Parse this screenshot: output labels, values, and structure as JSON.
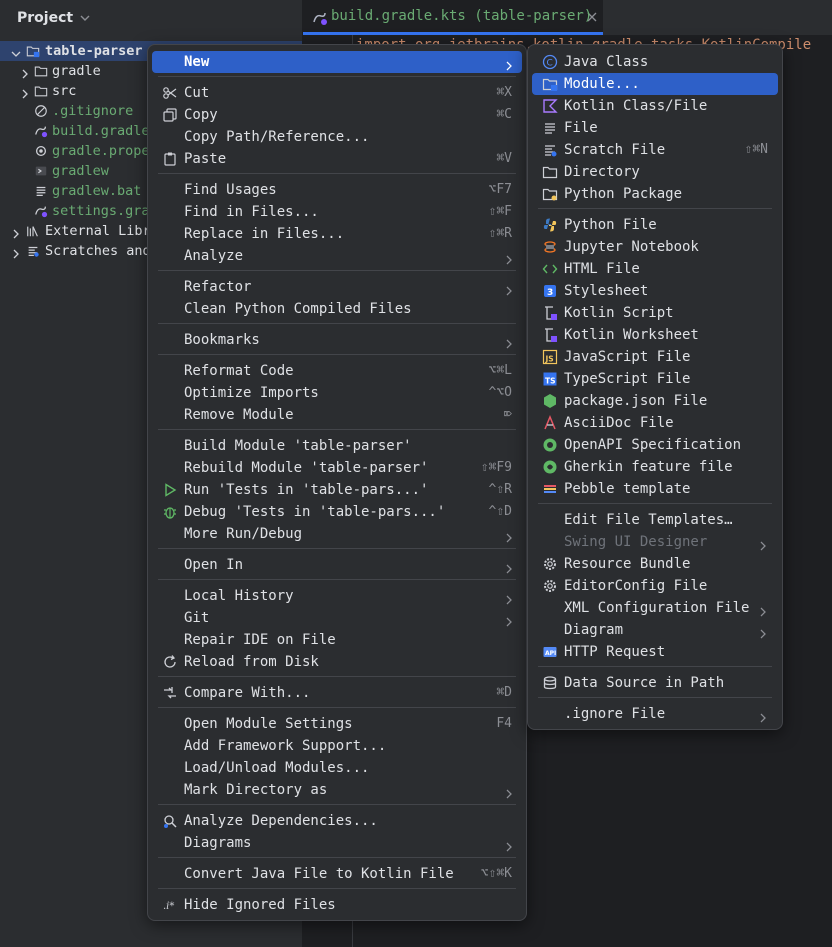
{
  "project_panel": {
    "title": "Project",
    "tree": [
      {
        "label": "table-parser",
        "icon": "module-folder-icon",
        "color": "#dfe1e5",
        "bold": true,
        "expanded": true
      },
      {
        "label": "gradle",
        "icon": "folder-icon",
        "color": "#dfe1e5"
      },
      {
        "label": "src",
        "icon": "folder-icon",
        "color": "#dfe1e5"
      },
      {
        "label": ".gitignore",
        "icon": "ignore-file-icon",
        "color": "#6aab73"
      },
      {
        "label": "build.gradle",
        "icon": "gradle-kts-icon",
        "color": "#6aab73"
      },
      {
        "label": "gradle.prope",
        "icon": "properties-file-icon",
        "color": "#6aab73"
      },
      {
        "label": "gradlew",
        "icon": "shell-script-icon",
        "color": "#6aab73"
      },
      {
        "label": "gradlew.bat",
        "icon": "text-file-icon",
        "color": "#6aab73"
      },
      {
        "label": "settings.gra",
        "icon": "gradle-kts-icon",
        "color": "#6aab73"
      },
      {
        "label": "External Libr",
        "icon": "library-icon",
        "color": "#dfe1e5"
      },
      {
        "label": "Scratches and",
        "icon": "scratches-icon",
        "color": "#dfe1e5"
      }
    ]
  },
  "editor": {
    "tab_label": "build.gradle.kts (table-parser)",
    "code_line": "import org.jetbrains.kotlin.gradle.tasks.KotlinCompile"
  },
  "context_menu": {
    "items": [
      {
        "label": "New",
        "shortcut": "",
        "submenu": true,
        "icon": ""
      },
      {
        "label": "Cut",
        "shortcut": "⌘X",
        "icon": "scissors-icon"
      },
      {
        "label": "Copy",
        "shortcut": "⌘C",
        "icon": "copy-icon"
      },
      {
        "label": "Copy Path/Reference...",
        "shortcut": "",
        "icon": ""
      },
      {
        "label": "Paste",
        "shortcut": "⌘V",
        "icon": "paste-icon"
      },
      {
        "label": "Find Usages",
        "shortcut": "⌥F7",
        "icon": ""
      },
      {
        "label": "Find in Files...",
        "shortcut": "⇧⌘F",
        "icon": ""
      },
      {
        "label": "Replace in Files...",
        "shortcut": "⇧⌘R",
        "icon": ""
      },
      {
        "label": "Analyze",
        "shortcut": "",
        "submenu": true,
        "icon": ""
      },
      {
        "label": "Refactor",
        "shortcut": "",
        "submenu": true,
        "icon": ""
      },
      {
        "label": "Clean Python Compiled Files",
        "shortcut": "",
        "icon": ""
      },
      {
        "label": "Bookmarks",
        "shortcut": "",
        "submenu": true,
        "icon": ""
      },
      {
        "label": "Reformat Code",
        "shortcut": "⌥⌘L",
        "icon": ""
      },
      {
        "label": "Optimize Imports",
        "shortcut": "^⌥O",
        "icon": ""
      },
      {
        "label": "Remove Module",
        "shortcut": "⌦",
        "icon": ""
      },
      {
        "label": "Build Module 'table-parser'",
        "shortcut": "",
        "icon": ""
      },
      {
        "label": "Rebuild Module 'table-parser'",
        "shortcut": "⇧⌘F9",
        "icon": ""
      },
      {
        "label": "Run 'Tests in 'table-pars...'",
        "shortcut": "^⇧R",
        "icon": "run-icon"
      },
      {
        "label": "Debug 'Tests in 'table-pars...'",
        "shortcut": "^⇧D",
        "icon": "debug-icon"
      },
      {
        "label": "More Run/Debug",
        "shortcut": "",
        "submenu": true,
        "icon": ""
      },
      {
        "label": "Open In",
        "shortcut": "",
        "submenu": true,
        "icon": ""
      },
      {
        "label": "Local History",
        "shortcut": "",
        "submenu": true,
        "icon": ""
      },
      {
        "label": "Git",
        "shortcut": "",
        "submenu": true,
        "icon": ""
      },
      {
        "label": "Repair IDE on File",
        "shortcut": "",
        "icon": ""
      },
      {
        "label": "Reload from Disk",
        "shortcut": "",
        "icon": "reload-icon"
      },
      {
        "label": "Compare With...",
        "shortcut": "⌘D",
        "icon": "compare-icon"
      },
      {
        "label": "Open Module Settings",
        "shortcut": "F4",
        "icon": ""
      },
      {
        "label": "Add Framework Support...",
        "shortcut": "",
        "icon": ""
      },
      {
        "label": "Load/Unload Modules...",
        "shortcut": "",
        "icon": ""
      },
      {
        "label": "Mark Directory as",
        "shortcut": "",
        "submenu": true,
        "icon": ""
      },
      {
        "label": "Analyze Dependencies...",
        "shortcut": "",
        "icon": "analyze-dependencies-icon"
      },
      {
        "label": "Diagrams",
        "shortcut": "",
        "submenu": true,
        "icon": ""
      },
      {
        "label": "Convert Java File to Kotlin File",
        "shortcut": "⌥⇧⌘K",
        "icon": ""
      },
      {
        "label": "Hide Ignored Files",
        "shortcut": "",
        "icon": "hide-ignored-icon"
      }
    ]
  },
  "new_submenu": {
    "items": [
      {
        "label": "Java Class",
        "shortcut": "",
        "icon": "java-class-icon"
      },
      {
        "label": "Module...",
        "shortcut": "",
        "icon": "module-icon"
      },
      {
        "label": "Kotlin Class/File",
        "shortcut": "",
        "icon": "kotlin-icon"
      },
      {
        "label": "File",
        "shortcut": "",
        "icon": "file-icon"
      },
      {
        "label": "Scratch File",
        "shortcut": "⇧⌘N",
        "icon": "scratch-file-icon"
      },
      {
        "label": "Directory",
        "shortcut": "",
        "icon": "directory-icon"
      },
      {
        "label": "Python Package",
        "shortcut": "",
        "icon": "python-package-icon"
      },
      {
        "label": "Python File",
        "shortcut": "",
        "icon": "python-file-icon"
      },
      {
        "label": "Jupyter Notebook",
        "shortcut": "",
        "icon": "jupyter-icon"
      },
      {
        "label": "HTML File",
        "shortcut": "",
        "icon": "html-icon"
      },
      {
        "label": "Stylesheet",
        "shortcut": "",
        "icon": "css-icon"
      },
      {
        "label": "Kotlin Script",
        "shortcut": "",
        "icon": "kotlin-script-icon"
      },
      {
        "label": "Kotlin Worksheet",
        "shortcut": "",
        "icon": "kotlin-worksheet-icon"
      },
      {
        "label": "JavaScript File",
        "shortcut": "",
        "icon": "javascript-icon"
      },
      {
        "label": "TypeScript File",
        "shortcut": "",
        "icon": "typescript-icon"
      },
      {
        "label": "package.json File",
        "shortcut": "",
        "icon": "nodejs-icon"
      },
      {
        "label": "AsciiDoc File",
        "shortcut": "",
        "icon": "asciidoc-icon"
      },
      {
        "label": "OpenAPI Specification",
        "shortcut": "",
        "icon": "openapi-icon"
      },
      {
        "label": "Gherkin feature file",
        "shortcut": "",
        "icon": "gherkin-icon"
      },
      {
        "label": "Pebble template",
        "shortcut": "",
        "icon": "pebble-icon"
      },
      {
        "label": "Edit File Templates…",
        "shortcut": "",
        "icon": ""
      },
      {
        "label": "Swing UI Designer",
        "shortcut": "",
        "icon": "",
        "disabled": true,
        "submenu": true
      },
      {
        "label": "Resource Bundle",
        "shortcut": "",
        "icon": "gear-icon"
      },
      {
        "label": "EditorConfig File",
        "shortcut": "",
        "icon": "gear-icon"
      },
      {
        "label": "XML Configuration File",
        "shortcut": "",
        "icon": "",
        "submenu": true
      },
      {
        "label": "Diagram",
        "shortcut": "",
        "icon": "",
        "submenu": true
      },
      {
        "label": "HTTP Request",
        "shortcut": "",
        "icon": "http-request-icon"
      },
      {
        "label": "Data Source in Path",
        "shortcut": "",
        "icon": "database-icon"
      },
      {
        "label": ".ignore File",
        "shortcut": "",
        "icon": "",
        "submenu": true
      }
    ]
  },
  "colors": {
    "accent": "#2e60c8",
    "selection": "#2e436e",
    "green_text": "#6aab73"
  }
}
